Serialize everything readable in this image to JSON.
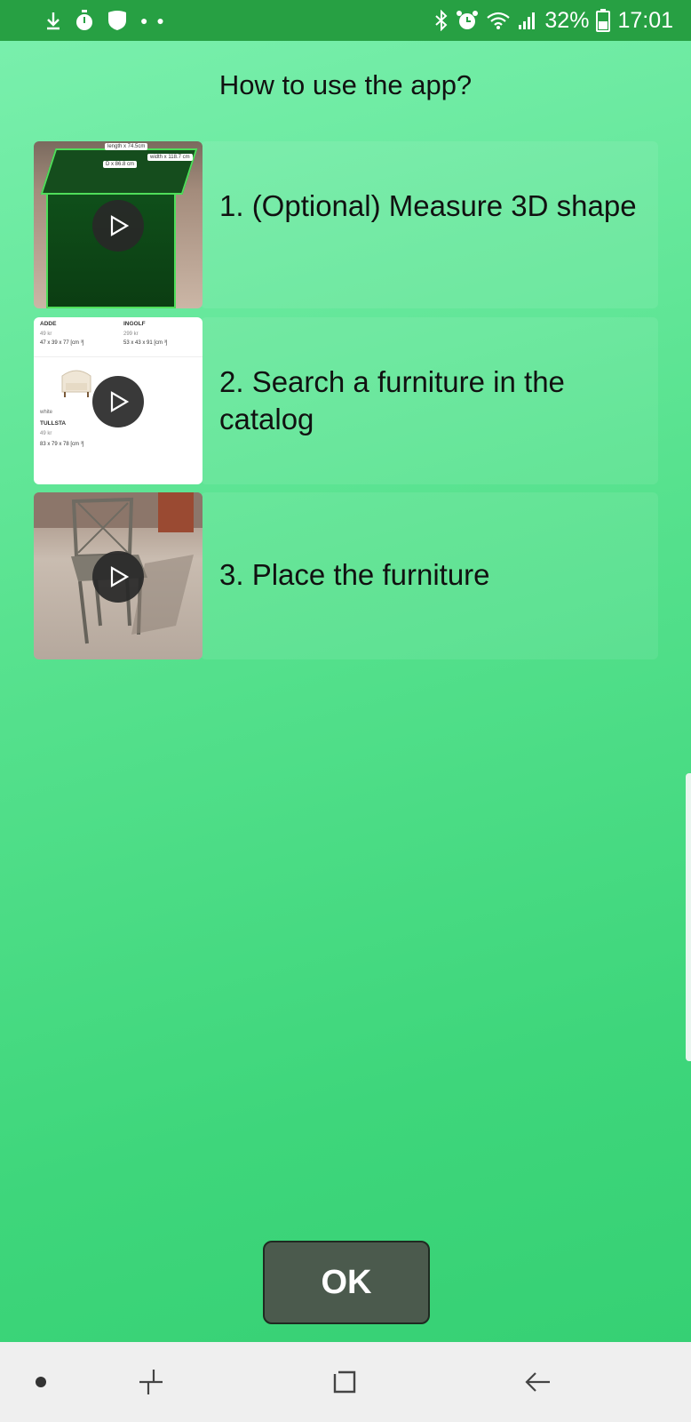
{
  "status_bar": {
    "left_icons": [
      "download-icon",
      "stopwatch-icon",
      "shield-icon",
      "more-dots-icon"
    ],
    "right_icons": [
      "bluetooth-icon",
      "alarm-icon",
      "wifi-icon",
      "signal-icon",
      "battery-icon"
    ],
    "battery": "32%",
    "time": "17:01",
    "background": "#27a043"
  },
  "title": "How to use the app?",
  "steps": [
    {
      "label": "1. (Optional) Measure 3D shape",
      "thumbnail": "measure-box-thumbnail"
    },
    {
      "label": "2. Search a furniture in the catalog",
      "thumbnail": "catalog-thumbnail"
    },
    {
      "label": "3. Place the furniture",
      "thumbnail": "chair-thumbnail"
    }
  ],
  "thumb1": {
    "tag_a": "length x 74.5cm",
    "tag_b": "D x 86.8 cm",
    "tag_c": "width x 118.7 cm"
  },
  "catalog": {
    "item1_name": "ADDE",
    "item1_price": "49 kr",
    "item1_size": "47 x 39 x 77 [cm ³]",
    "item2_name": "INGOLF",
    "item2_price": "299 kr",
    "item2_size": "53 x 43 x 91 [cm ³]",
    "item3_color": "white",
    "item3_name": "TULLSTA",
    "item3_price": "49 kr",
    "item3_size": "83 x 79 x 78 [cm ³]"
  },
  "ok_button": {
    "label": "OK"
  },
  "nav_bar": {
    "items": [
      "home-dot-icon",
      "recent-apps-icon",
      "home-square-icon",
      "back-arrow-icon"
    ]
  }
}
